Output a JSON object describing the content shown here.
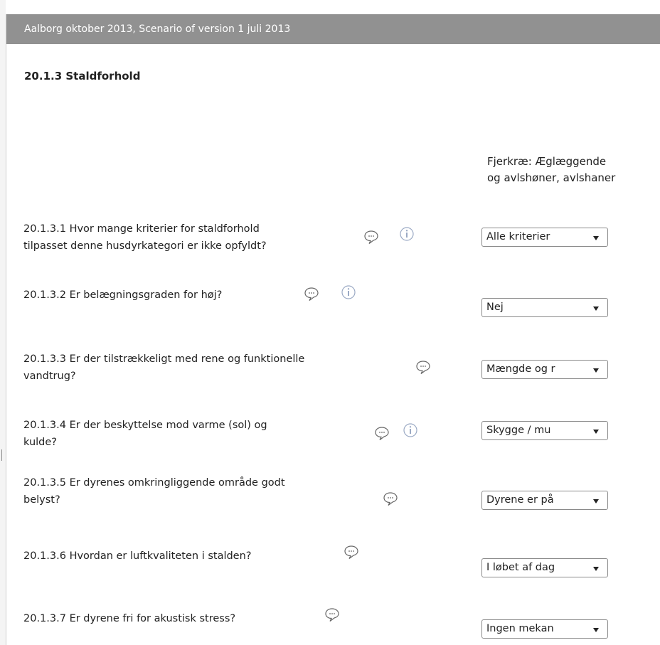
{
  "header": {
    "title": "Aalborg oktober 2013, Scenario of version 1 juli 2013"
  },
  "section": {
    "title": "20.1.3  Staldforhold"
  },
  "column": {
    "header": "Fjerkræ: Æglæggende og avlshøner, avlshaner"
  },
  "questions": [
    {
      "text_lines": [
        "20.1.3.1 Hvor mange kriterier for staldforhold",
        "tilpasset denne husdyrkategori er ikke opfyldt?"
      ],
      "value": "Alle kriterier",
      "has_comment": true,
      "has_info": true
    },
    {
      "text_lines": [
        "20.1.3.2 Er belægningsgraden for høj?"
      ],
      "value": "Nej",
      "has_comment": true,
      "has_info": true
    },
    {
      "text_lines": [
        "20.1.3.3 Er der tilstrækkeligt med rene og funktionelle",
        "vandtrug?"
      ],
      "value": "Mængde og r",
      "has_comment": true,
      "has_info": false
    },
    {
      "text_lines": [
        "20.1.3.4 Er der beskyttelse mod varme (sol) og",
        "kulde?"
      ],
      "value": "Skygge / mu",
      "has_comment": true,
      "has_info": true
    },
    {
      "text_lines": [
        "20.1.3.5 Er dyrenes omkringliggende område godt",
        "belyst?"
      ],
      "value": "Dyrene er på",
      "has_comment": true,
      "has_info": false
    },
    {
      "text_lines": [
        "20.1.3.6 Hvordan er luftkvaliteten i stalden?"
      ],
      "value": "I løbet af dag",
      "has_comment": true,
      "has_info": false
    },
    {
      "text_lines": [
        "20.1.3.7 Er dyrene fri for akustisk stress?"
      ],
      "value": "Ingen mekan",
      "has_comment": true,
      "has_info": false
    }
  ],
  "icons": {
    "comment": "speech-bubble-icon",
    "info": "info-icon",
    "dropdown": "chevron-down-icon"
  }
}
